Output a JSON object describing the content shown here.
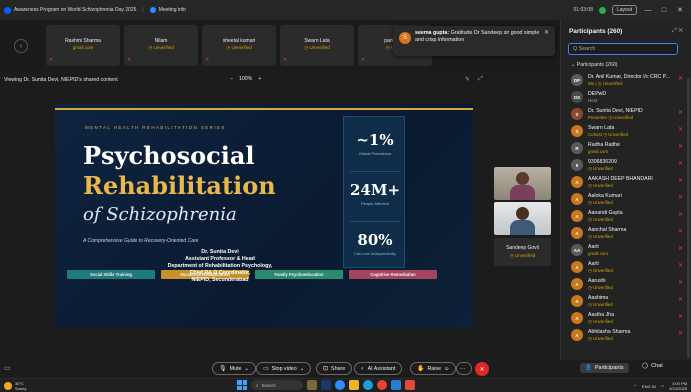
{
  "window": {
    "title": "Awareness Program on World Schizophrenia Day 2025",
    "sub": "Meeting info",
    "clock": "01:03:08",
    "layout_btn": "Layout",
    "min": "—",
    "max": "□",
    "close": "✕"
  },
  "gallery": {
    "prev": "‹",
    "tiles": [
      {
        "name": "Rashmi Sharma",
        "status": "gmail.com"
      },
      {
        "name": "Nilam",
        "status": "◷ Unverified"
      },
      {
        "name": "sheetal kumari",
        "status": "◷ Unverified"
      },
      {
        "name": "Swarn Lata",
        "status": "◷ Unverified"
      },
      {
        "name": "pankaj sh",
        "status": "◷ Unveri"
      }
    ]
  },
  "toast": {
    "avatar": "S",
    "sender": "seema gupta:",
    "message": "Gratitude Dr Sandeep sir good simple and crisp information",
    "close": "✕"
  },
  "share": {
    "label": "Viewing Dr. Sunita Devi, NIEPID's shared content",
    "zoom_out": "−",
    "zoom": "100%",
    "zoom_in": "+"
  },
  "slide": {
    "series": "MENTAL HEALTH REHABILITATION SERIES",
    "title1": "Psychosocial",
    "title2": "Rehabilitation",
    "title3": "of Schizophrenia",
    "guide": "A Comprehensive Guide to Recovery-Oriented Care",
    "author": [
      "Dr. Sunita Devi",
      "Assistant Professor & Head",
      "Department of Rehabilitation Psychology,",
      "Chief R& D Coordinator,",
      "NIEPID, Secunderabad"
    ],
    "stats": [
      {
        "value": "~1%",
        "caption": "Global Prevalence"
      },
      {
        "value": "24M+",
        "caption": "People Affected"
      },
      {
        "value": "80%",
        "caption": "Can Live Independently"
      }
    ],
    "pills": [
      {
        "label": "Social Skills Training",
        "color": "#1e7b7b"
      },
      {
        "label": "Vocational Rehabilitation",
        "color": "#c8922b"
      },
      {
        "label": "Family Psychoeducation",
        "color": "#2a8a6e"
      },
      {
        "label": "Cognitive Remediation",
        "color": "#a5455b"
      }
    ]
  },
  "videos": {
    "tile3_name": "Sandeep Govil",
    "tile3_status": "◷ Unverified"
  },
  "panel": {
    "title": "Participants (260)",
    "icons": "⤢ ✕",
    "search_placeholder": "Q  Search",
    "group": "⌄  Participants (260)",
    "people": [
      {
        "initials": "DP",
        "color": "#5a5a5a",
        "name": "Dr. Anil Kumar, Director i/c CRC P...",
        "status": "Me  |  ◷ Unverified",
        "mic": "✕",
        "host": false
      },
      {
        "initials": "DS",
        "color": "#4a4a4a",
        "name": "DEPwD",
        "status": "Host",
        "mic": "",
        "host": true
      },
      {
        "initials": "S",
        "color": "#8b4a2b",
        "name": "Dr. Sunita Devi, NIEPID",
        "status": "Presenter  ◷ Unverified",
        "mic": "✕",
        "host": false
      },
      {
        "initials": "S",
        "color": "#c9781e",
        "name": "Swarn Lata",
        "status": "Cohost  ◷ Unverified",
        "mic": "✕",
        "host": false
      },
      {
        "initials": "R",
        "color": "#5a5a5a",
        "name": "Radha Radhe",
        "status": "gmail.com",
        "mic": "✕",
        "host": false
      },
      {
        "initials": "9",
        "color": "#5a5a5a",
        "name": "9306836209",
        "status": "◷ Unverified",
        "mic": "✕",
        "host": false
      },
      {
        "initials": "A",
        "color": "#c9781e",
        "name": "AAKASH DEEP BHANDARI",
        "status": "◷ Unverified",
        "mic": "✕",
        "host": false
      },
      {
        "initials": "A",
        "color": "#c9781e",
        "name": "Aaloka Kumari",
        "status": "◷ Unverified",
        "mic": "✕",
        "host": false
      },
      {
        "initials": "A",
        "color": "#c9781e",
        "name": "Aanandi Gupta",
        "status": "◷ Unverified",
        "mic": "✕",
        "host": false
      },
      {
        "initials": "A",
        "color": "#c9781e",
        "name": "Aanchal Sharma",
        "status": "◷ Unverified",
        "mic": "✕",
        "host": false
      },
      {
        "initials": "AA",
        "color": "#5a5a5a",
        "name": "Aarti",
        "status": "gmail.com",
        "mic": "✕",
        "host": false
      },
      {
        "initials": "A",
        "color": "#c9781e",
        "name": "Aarti",
        "status": "◷ Unverified",
        "mic": "✕",
        "host": false
      },
      {
        "initials": "A",
        "color": "#c9781e",
        "name": "Aarushi",
        "status": "◷ Unverified",
        "mic": "✕",
        "host": false
      },
      {
        "initials": "A",
        "color": "#c9781e",
        "name": "Aashima",
        "status": "◷ Unverified",
        "mic": "✕",
        "host": false
      },
      {
        "initials": "A",
        "color": "#c9781e",
        "name": "Aastha Jha",
        "status": "◷ Unverified",
        "mic": "✕",
        "host": false
      },
      {
        "initials": "A",
        "color": "#c9781e",
        "name": "Abhilasha Sharma",
        "status": "◷ Unverified",
        "mic": "✕",
        "host": false
      }
    ]
  },
  "toolbar": {
    "mute": "Mute",
    "stop_video": "Stop video",
    "share": "Share",
    "ai": "AI Assistant",
    "raise": "Raise",
    "more": "···",
    "participants": "Participants",
    "chat": "Chat"
  },
  "taskbar": {
    "temp": "30°C",
    "weather": "Sunny",
    "search": "Search",
    "lang": "ENG IN",
    "time": "3:00 PM",
    "date": "5/24/2025"
  }
}
